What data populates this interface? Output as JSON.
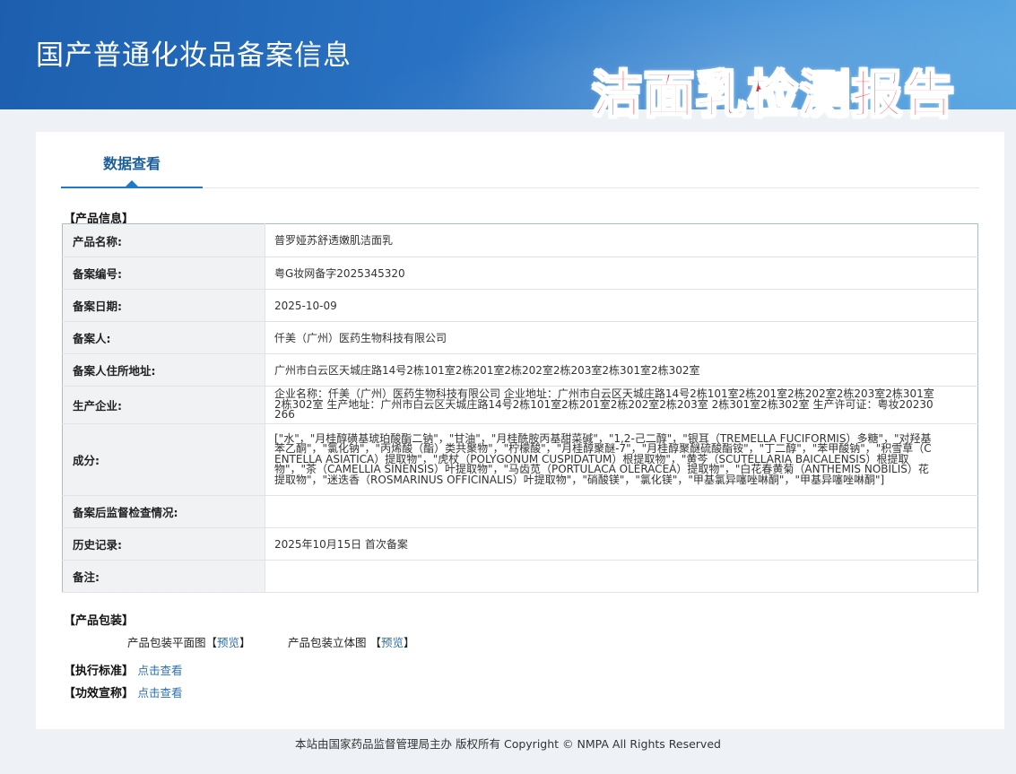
{
  "header": {
    "site_title": "国产普通化妆品备案信息",
    "overlay_title": "洁面乳检测报告"
  },
  "tabs": [
    {
      "label": "数据查看",
      "active": true
    }
  ],
  "product_info": {
    "section_title": "【产品信息】",
    "rows": [
      {
        "label": "产品名称:",
        "value": "普罗娅苏舒透嫩肌洁面乳"
      },
      {
        "label": "备案编号:",
        "value": "粤G妆网备字2025345320"
      },
      {
        "label": "备案日期:",
        "value": "2025-10-09"
      },
      {
        "label": "备案人:",
        "value": "仟美（广州）医药生物科技有限公司"
      },
      {
        "label": "备案人住所地址:",
        "value": "广州市白云区天城庄路14号2栋101室2栋201室2栋202室2栋203室2栋301室2栋302室"
      },
      {
        "label": "生产企业:",
        "value": "企业名称：仟美（广州）医药生物科技有限公司 企业地址：广州市白云区天城庄路14号2栋101室2栋201室2栋202室2栋203室2栋301室2栋302室 生产地址：广州市白云区天城庄路14号2栋101室2栋201室2栋202室2栋203室 2栋301室2栋302室 生产许可证：粤妆20230266"
      },
      {
        "label": "成分:",
        "value": "[\"水\"，\"月桂醇磺基琥珀酸酯二钠\"，\"甘油\"，\"月桂酰胺丙基甜菜碱\"，\"1,2-己二醇\"，\"银耳（TREMELLA FUCIFORMIS）多糖\"，\"对羟基苯乙酮\"，\"氯化钠\"，\"丙烯酸（酯）类共聚物\"，\"柠檬酸\"，\"月桂醇聚醚-7\"，\"月桂醇聚醚硫酸酯铵\"，\"丁二醇\"，\"苯甲酸钠\"，\"积雪草（CENTELLA ASIATICA）提取物\"，\"虎杖（POLYGONUM CUSPIDATUM）根提取物\"，\"黄芩（SCUTELLARIA BAICALENSIS）根提取物\"，\"茶（CAMELLIA SINENSIS）叶提取物\"，\"马齿苋（PORTULACA OLERACEA）提取物\"，\"白花春黄菊（ANTHEMIS NOBILIS）花提取物\"，\"迷迭香（ROSMARINUS OFFICINALIS）叶提取物\"，\"硝酸镁\"，\"氯化镁\"，\"甲基氯异噻唑啉酮\"，\"甲基异噻唑啉酮\"]"
      },
      {
        "label": "备案后监督检查情况:",
        "value": ""
      },
      {
        "label": "历史记录:",
        "value": "2025年10月15日 首次备案"
      },
      {
        "label": "备注:",
        "value": ""
      }
    ]
  },
  "packaging": {
    "section_title": "【产品包装】",
    "flat_label": "产品包装平面图",
    "solid_label": "产品包装立体图",
    "bracket_open": "【",
    "bracket_close": "】",
    "preview_link": "预览"
  },
  "standard": {
    "label": "【执行标准】",
    "link": "点击查看"
  },
  "efficacy": {
    "label": "【功效宣称】",
    "link": "点击查看"
  },
  "footer": {
    "text": "本站由国家药品监督管理局主办 版权所有 Copyright © NMPA All Rights Reserved"
  }
}
